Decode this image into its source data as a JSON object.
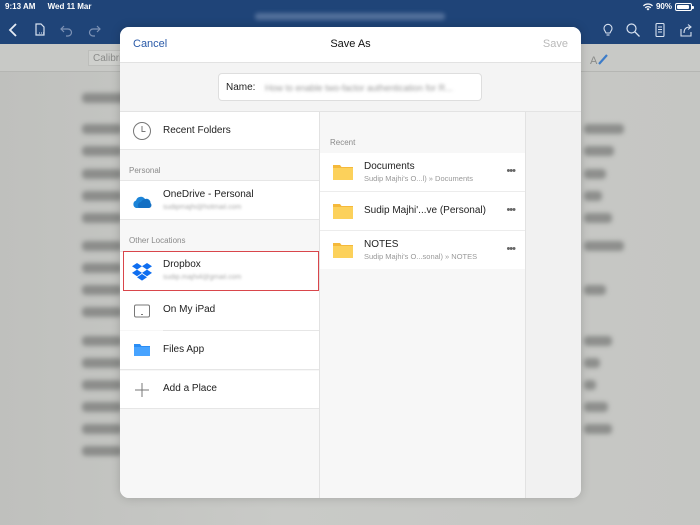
{
  "status_bar": {
    "time": "9:13 AM",
    "date": "Wed 11 Mar",
    "battery_percent": "90%",
    "battery_level": 0.9
  },
  "toolbar": {
    "left_icons": [
      "back-icon",
      "file-icon",
      "undo-icon",
      "redo-icon"
    ],
    "right_icons": [
      "lightbulb-icon",
      "search-icon",
      "reading-view-icon",
      "share-icon"
    ]
  },
  "ribbon": {
    "font_name": "Calibri"
  },
  "dialog": {
    "title": "Save As",
    "cancel_label": "Cancel",
    "save_label": "Save",
    "name_label": "Name:",
    "name_value": "How to enable two-factor authentication for R..."
  },
  "locations": {
    "recent_folders_label": "Recent Folders",
    "personal_section": "Personal",
    "onedrive": {
      "label": "OneDrive - Personal",
      "account": "sudipmajhi@hotmail.com"
    },
    "other_section": "Other Locations",
    "dropbox": {
      "label": "Dropbox",
      "account": "sudip.majhi4@gmail.com"
    },
    "on_my_ipad": "On My iPad",
    "files_app": "Files App",
    "add_place": "Add a Place"
  },
  "recent": {
    "section_label": "Recent",
    "items": [
      {
        "name": "Documents",
        "path": "Sudip Majhi's O...l) » Documents"
      },
      {
        "name": "Sudip Majhi'...ve (Personal)",
        "path": ""
      },
      {
        "name": "NOTES",
        "path": "Sudip Majhi's O...sonal) » NOTES"
      }
    ],
    "more_label": "•••"
  },
  "colors": {
    "accent_blue": "#2a5aa8",
    "toolbar_bg": "#1f4478",
    "highlight_red": "#d9464b",
    "folder_yellow": "#fcd15b",
    "onedrive_blue": "#1b84d8",
    "dropbox_blue": "#0f6ef0"
  }
}
